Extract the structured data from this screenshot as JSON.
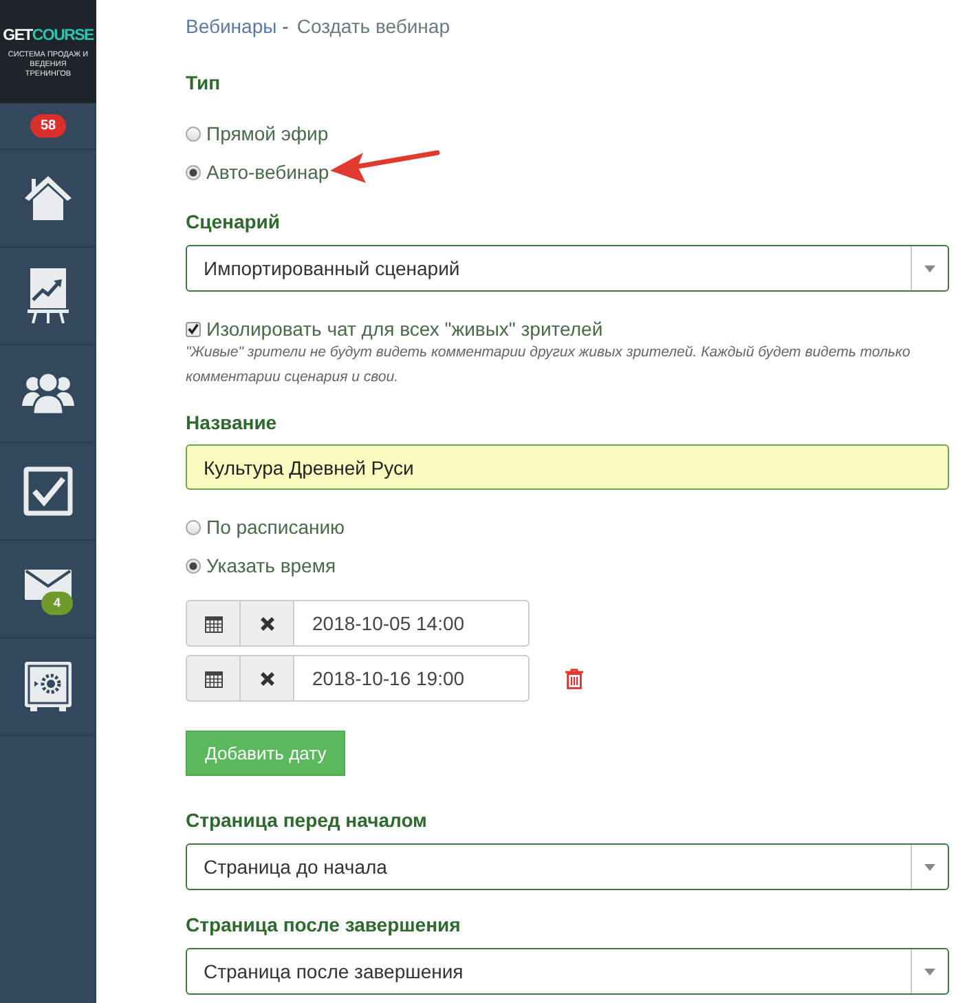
{
  "sidebar": {
    "logo": {
      "part1": "GET",
      "part2": "COURSE",
      "tagline": "СИСТЕМА ПРОДАЖ И ВЕДЕНИЯ ТРЕНИНГОВ"
    },
    "notifications": "58",
    "items": [
      {
        "kind": "home"
      },
      {
        "kind": "chart"
      },
      {
        "kind": "users"
      },
      {
        "kind": "tasks"
      },
      {
        "kind": "mail",
        "badge": "4"
      },
      {
        "kind": "safe"
      }
    ]
  },
  "breadcrumb": {
    "link": "Вебинары",
    "separator": "-",
    "current": "Создать вебинар"
  },
  "type": {
    "label": "Тип",
    "options": [
      {
        "label": "Прямой эфир",
        "selected": false
      },
      {
        "label": "Авто-вебинар",
        "selected": true
      }
    ]
  },
  "scenario": {
    "label": "Сценарий",
    "value": "Импортированный сценарий"
  },
  "isolate_chat": {
    "label": "Изолировать чат для всех \"живых\" зрителей",
    "checked": true,
    "hint": "\"Живые\" зрители не будут видеть комментарии других живых зрителей. Каждый будет видеть только комментарии сценария и свои."
  },
  "name": {
    "label": "Название",
    "value": "Культура Древней Руси"
  },
  "schedule": {
    "options": [
      {
        "label": "По расписанию",
        "selected": false
      },
      {
        "label": "Указать время",
        "selected": true
      }
    ]
  },
  "dates": [
    {
      "value": "2018-10-05 14:00",
      "deletable": false
    },
    {
      "value": "2018-10-16 19:00",
      "deletable": true
    }
  ],
  "add_date_button": "Добавить дату",
  "page_before": {
    "label": "Страница перед началом",
    "value": "Страница до начала"
  },
  "page_after": {
    "label": "Страница после завершения",
    "value": "Страница после завершения"
  }
}
